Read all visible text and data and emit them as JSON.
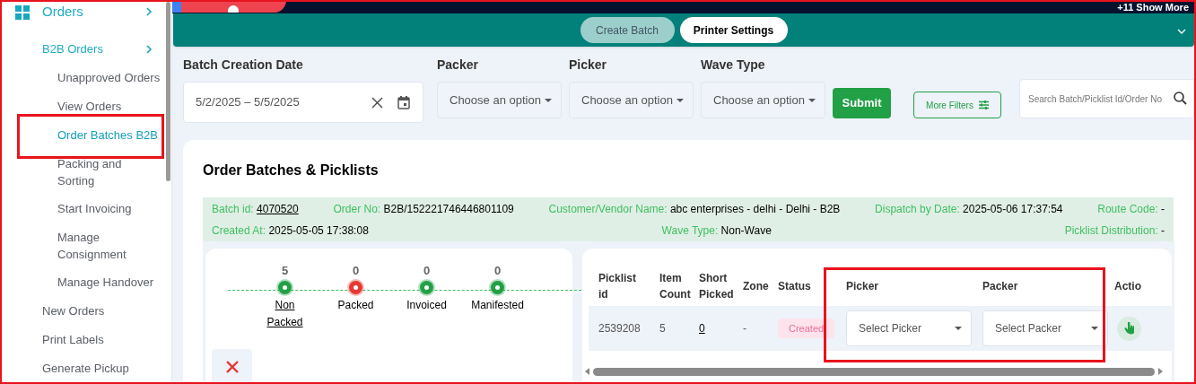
{
  "top_banner": {
    "text": "+11 Show More"
  },
  "sidebar": {
    "items": [
      {
        "label": "Orders",
        "expanded": true,
        "selected": false,
        "highlighted": false,
        "children": [
          {
            "label": "B2B Orders",
            "expanded": true,
            "selected": false,
            "highlighted": false,
            "children": [
              {
                "label": "Unapproved Orders",
                "selected": false,
                "highlighted": false
              },
              {
                "label": "View Orders",
                "selected": false,
                "highlighted": false
              },
              {
                "label": "Order Batches B2B",
                "selected": true,
                "highlighted": true
              },
              {
                "label": "Packing and Sorting",
                "selected": false,
                "highlighted": false
              },
              {
                "label": "Start Invoicing",
                "selected": false,
                "highlighted": false
              },
              {
                "label": "Manage Consignment",
                "selected": false,
                "highlighted": false
              },
              {
                "label": "Manage Handover",
                "selected": false,
                "highlighted": false
              }
            ]
          },
          {
            "label": "New Orders",
            "selected": false,
            "highlighted": false
          },
          {
            "label": "Print Labels",
            "selected": false,
            "highlighted": false
          },
          {
            "label": "Generate Pickup",
            "selected": false,
            "highlighted": false
          }
        ]
      }
    ]
  },
  "toolbar": {
    "buttons": [
      {
        "label": "Create Batch",
        "disabled": true
      },
      {
        "label": "Printer Settings",
        "disabled": false
      }
    ]
  },
  "filters": {
    "date": {
      "label": "Batch Creation Date",
      "value": "5/2/2025 – 5/5/2025"
    },
    "selects": [
      {
        "label": "Packer",
        "placeholder": "Choose an option"
      },
      {
        "label": "Picker",
        "placeholder": "Choose an option"
      },
      {
        "label": "Wave Type",
        "placeholder": "Choose an option"
      }
    ],
    "submit": "Submit",
    "more_filters": "More Filters",
    "search": {
      "placeholder": "Search Batch/Picklist Id/Order No"
    }
  },
  "card": {
    "title": "Order Batches & Picklists",
    "info_rows": [
      [
        {
          "label": "Batch id:",
          "value": "4070520",
          "link": true
        },
        {
          "label": "Order No:",
          "value": "B2B/152221746446801109",
          "link": false
        },
        {
          "label": "Customer/Vendor Name:",
          "value": "abc enterprises - delhi - Delhi - B2B",
          "link": false
        },
        {
          "label": "Dispatch by Date:",
          "value": "2025-05-06 17:37:54",
          "link": false
        },
        {
          "label": "Route Code:",
          "value": "-",
          "link": false
        }
      ],
      [
        {
          "label": "Created At:",
          "value": "2025-05-05 17:38:08",
          "link": false
        },
        {
          "label": "Wave Type:",
          "value": "Non-Wave",
          "link": false
        },
        {
          "label": "Picklist Distribution:",
          "value": "-",
          "link": false
        }
      ]
    ],
    "steps": [
      {
        "count": "5",
        "label": "Non Packed",
        "color": "#22a045",
        "link": true
      },
      {
        "count": "0",
        "label": "Packed",
        "color": "#e53935",
        "link": false
      },
      {
        "count": "0",
        "label": "Invoiced",
        "color": "#22a045",
        "link": false
      },
      {
        "count": "0",
        "label": "Manifested",
        "color": "#22a045",
        "link": false
      }
    ],
    "table": {
      "columns": [
        "Picklist id",
        "Item Count",
        "Short Picked",
        "Zone",
        "Status",
        "Picker",
        "Packer",
        "Actio"
      ],
      "highlight_picker_packer": true,
      "rows": [
        {
          "picklist_id": "2539208",
          "item_count": "5",
          "short_picked": "0",
          "zone": "-",
          "status": "Created",
          "picker": {
            "placeholder": "Select Picker"
          },
          "packer": {
            "placeholder": "Select Packer"
          }
        }
      ]
    }
  }
}
